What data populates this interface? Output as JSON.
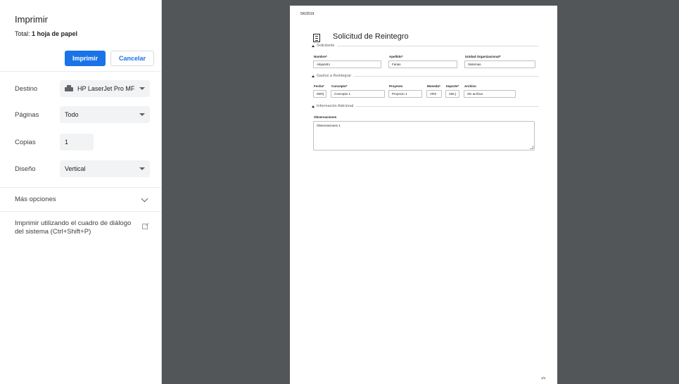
{
  "sidebar": {
    "title": "Imprimir",
    "total_prefix": "Total: ",
    "total_value": "1 hoja de papel",
    "print_button": "Imprimir",
    "cancel_button": "Cancelar",
    "destination_label": "Destino",
    "destination_value": "HP LaserJet Pro MF",
    "pages_label": "Páginas",
    "pages_value": "Todo",
    "copies_label": "Copias",
    "copies_value": "1",
    "layout_label": "Diseño",
    "layout_value": "Vertical",
    "more_options": "Más opciones",
    "system_dialog": "Imprimir utilizando el cuadro de diálogo del sistema (Ctrl+Shift+P)"
  },
  "paper": {
    "date": "5/6/2019",
    "title": "Solicitud de Reintegro",
    "sec_solicitante": "Solicitante",
    "nombre_label": "Nombre*",
    "nombre_value": "Alejandro",
    "apellido_label": "Apellido*",
    "apellido_value": "Farias",
    "unidad_label": "Unidad Organizacional*",
    "unidad_value": "Sistemas",
    "sec_gastos": "Gastos a Reintegrar",
    "fecha_label": "Fecha*",
    "fecha_value": "05/0(",
    "concepto_label": "Concepto*",
    "concepto_value": "Concepto 1",
    "proyecto_label": "Proyecto",
    "proyecto_value": "Proyecto 1",
    "moneda_label": "Moneda*",
    "moneda_value": "ARS",
    "importe_label": "Importe*",
    "importe_value": "250,(",
    "archivo_label": "Archivo",
    "archivo_value": "Sin archivo",
    "sec_info": "Información Adicional",
    "obs_label": "Observaciones",
    "obs_value": "Observaciones 1",
    "page_number": "1/1"
  }
}
